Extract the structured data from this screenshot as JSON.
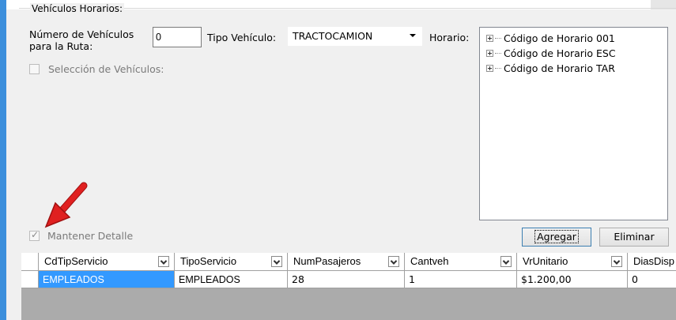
{
  "vehiculos": {
    "group_title": "Vehículos Horarios:",
    "num_label": "Número de Vehículos para la Ruta:",
    "num_value": "0",
    "tipo_label": "Tipo Vehículo:",
    "tipo_value": "TRACTOCAMION",
    "horario_label": "Horario:",
    "seleccion_label": "Selección de Vehículos:",
    "horarios": [
      "Código de Horario 001",
      "Código de Horario ESC",
      "Código de Horario TAR"
    ]
  },
  "detalle": {
    "mantener_label": "Mantener Detalle",
    "mantener_checked": true,
    "agregar_label": "Agregar",
    "eliminar_label": "Eliminar"
  },
  "grid": {
    "columns": [
      "CdTipServicio",
      "TipoServicio",
      "NumPasajeros",
      "Cantveh",
      "VrUnitario",
      "DiasDisp"
    ],
    "rows": [
      [
        "EMPLEADOS",
        "EMPLEADOS",
        "28",
        "1",
        "$1.200,00",
        "0"
      ]
    ]
  },
  "icons": {
    "annotation": "red-arrow-icon",
    "expand": "plus-expander-icon",
    "dropdown": "chevron-down-icon"
  },
  "colors": {
    "accent_bar": "#3c8fdc",
    "selection": "#3399ff",
    "arrow": "#e02020"
  }
}
